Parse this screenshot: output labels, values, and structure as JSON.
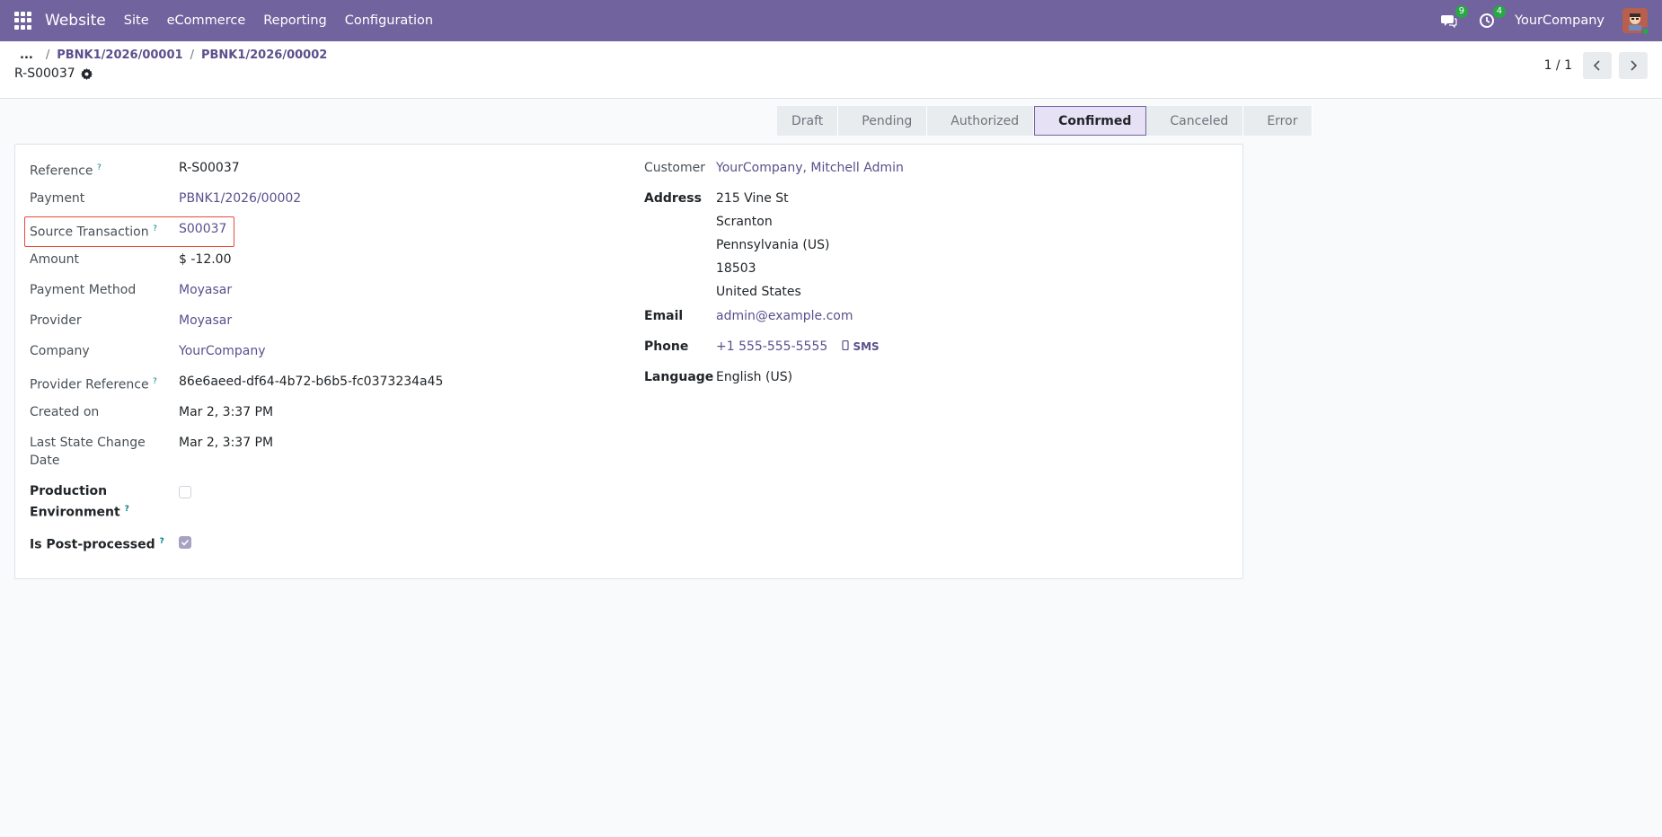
{
  "topbar": {
    "brand": "Website",
    "menu": [
      "Site",
      "eCommerce",
      "Reporting",
      "Configuration"
    ],
    "messages_count": "9",
    "activities_count": "4",
    "company": "YourCompany"
  },
  "breadcrumb": {
    "ellipsis": "...",
    "items": [
      "PBNK1/2026/00001",
      "PBNK1/2026/00002"
    ],
    "current": "R-S00037"
  },
  "pager": {
    "value": "1 / 1"
  },
  "statusbar": [
    "Draft",
    "Pending",
    "Authorized",
    "Confirmed",
    "Canceled",
    "Error"
  ],
  "form": {
    "left": {
      "reference_label": "Reference",
      "reference": "R-S00037",
      "payment_label": "Payment",
      "payment": "PBNK1/2026/00002",
      "source_label": "Source Transaction",
      "source": "S00037",
      "amount_label": "Amount",
      "amount": "$ -12.00",
      "method_label": "Payment Method",
      "method": "Moyasar",
      "provider_label": "Provider",
      "provider": "Moyasar",
      "company_label": "Company",
      "company": "YourCompany",
      "provider_ref_label": "Provider Reference",
      "provider_ref": "86e6aeed-df64-4b72-b6b5-fc0373234a45",
      "created_label": "Created on",
      "created": "Mar 2, 3:37 PM",
      "last_state_label": "Last State Change Date",
      "last_state": "Mar 2, 3:37 PM",
      "production_label": "Production Environment",
      "production": false,
      "postprocessed_label": "Is Post-processed",
      "postprocessed": true
    },
    "right": {
      "customer_label": "Customer",
      "customer": "YourCompany, Mitchell Admin",
      "address_label": "Address",
      "address": [
        "215 Vine St",
        "Scranton",
        "Pennsylvania (US)",
        "18503",
        "United States"
      ],
      "email_label": "Email",
      "email": "admin@example.com",
      "phone_label": "Phone",
      "phone": "+1 555-555-5555",
      "sms_label": "SMS",
      "language_label": "Language",
      "language": "English (US)"
    }
  },
  "help_marker": "?"
}
